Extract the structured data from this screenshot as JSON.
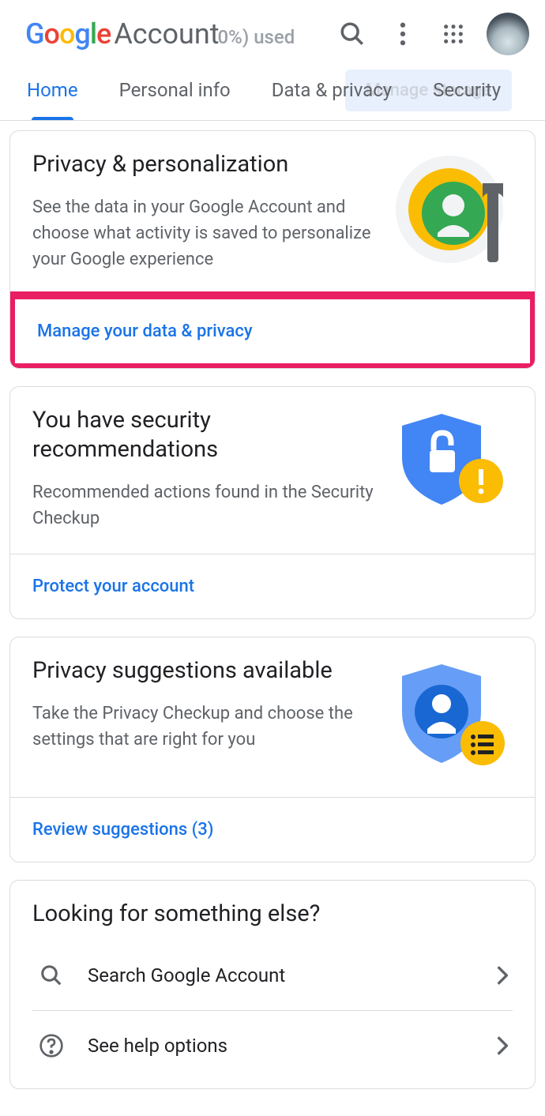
{
  "header": {
    "logo_google": "Google",
    "logo_account": "Account",
    "storage_used_fragment": "0%) used",
    "manage_storage": "Manage storage"
  },
  "tabs": {
    "home": "Home",
    "personal_info": "Personal info",
    "data_privacy": "Data & privacy",
    "security": "Security"
  },
  "cards": {
    "privacy": {
      "title": "Privacy & personalization",
      "desc": "See the data in your Google Account and choose what activity is saved to personalize your Google experience",
      "action": "Manage your data & privacy"
    },
    "security": {
      "title": "You have security recommendations",
      "desc": "Recommended actions found in the Security Checkup",
      "action": "Protect your account"
    },
    "suggestions": {
      "title": "Privacy suggestions available",
      "desc": "Take the Privacy Checkup and choose the settings that are right for you",
      "action": "Review suggestions (3)"
    },
    "looking": {
      "title": "Looking for something else?",
      "search": "Search Google Account",
      "help": "See help options"
    }
  }
}
